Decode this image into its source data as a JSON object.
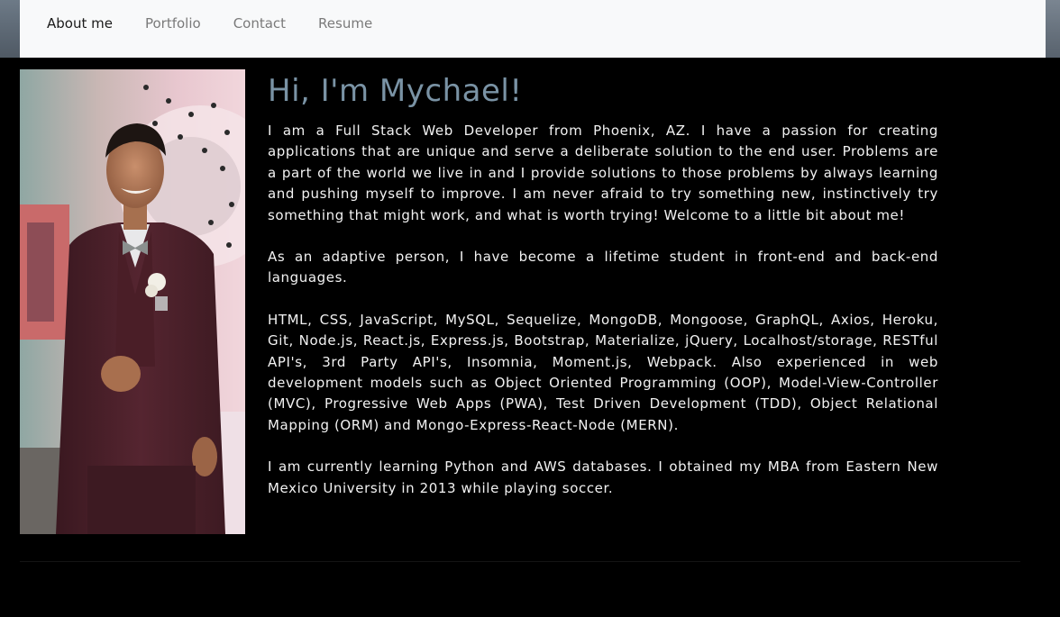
{
  "nav": {
    "items": [
      {
        "label": "About me",
        "active": true
      },
      {
        "label": "Portfolio",
        "active": false
      },
      {
        "label": "Contact",
        "active": false
      },
      {
        "label": "Resume",
        "active": false
      }
    ]
  },
  "about": {
    "heading": "Hi, I'm Mychael!",
    "paragraphs": [
      "I am a Full Stack Web Developer from Phoenix, AZ. I have a passion for creating applications that are unique and serve a deliberate solution to the end user. Problems are a part of the world we live in and I provide solutions to those problems by always learning and pushing myself to improve. I am never afraid to try something new, instinctively try something that might work, and what is worth trying! Welcome to a little bit about me!",
      "As an adaptive person, I have become a lifetime student in front-end and back-end languages.",
      "HTML, CSS, JavaScript, MySQL, Sequelize, MongoDB, Mongoose, GraphQL, Axios, Heroku, Git, Node.js, React.js, Express.js, Bootstrap, Materialize, jQuery, Localhost/storage, RESTful API's, 3rd Party API's, Insomnia, Moment.js, Webpack. Also experienced in web development models such as Object Oriented Programming (OOP), Model-View-Controller (MVC), Progressive Web Apps (PWA), Test Driven Development (TDD), Object Relational Mapping (ORM) and Mongo-Express-React-Node (MERN).",
      "I am currently learning Python and AWS databases. I obtained my MBA from Eastern New Mexico University in 2013 while playing soccer."
    ]
  },
  "colors": {
    "nav_bg": "#f8f9fa",
    "nav_active": "#1a1a1a",
    "nav_inactive": "#7a7a7a",
    "page_bg": "#000000",
    "heading": "#7a93a5",
    "body_text": "#f2f2f2"
  }
}
